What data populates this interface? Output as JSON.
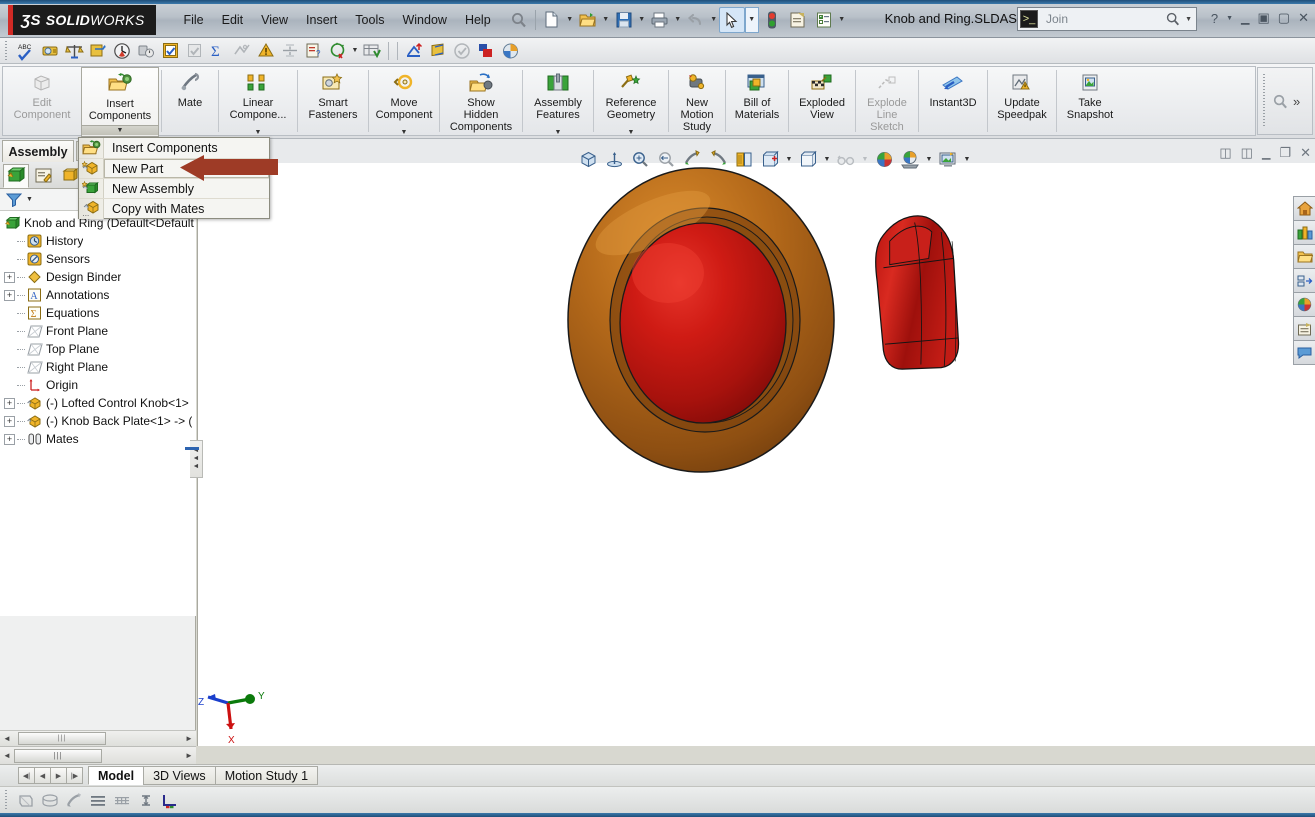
{
  "window": {
    "brand_ds": "ƷS",
    "brand_solid": "SOLID",
    "brand_works": "WORKS",
    "document_title": "Knob and Ring.SLDASM",
    "join_label": "Join",
    "join_icon": "console-icon",
    "search_icon": "magnifier-icon",
    "help_icon": "question-mark-icon",
    "minimize_icon": "minimize-icon",
    "restore_icon": "restore-icon",
    "close_icon": "close-icon",
    "accent_blue": "#2d64b0",
    "logo_red": "#d12a25"
  },
  "menu": {
    "items": [
      {
        "label": "File",
        "name": "menu-file"
      },
      {
        "label": "Edit",
        "name": "menu-edit"
      },
      {
        "label": "View",
        "name": "menu-view"
      },
      {
        "label": "Insert",
        "name": "menu-insert"
      },
      {
        "label": "Tools",
        "name": "menu-tools"
      },
      {
        "label": "Window",
        "name": "menu-window"
      },
      {
        "label": "Help",
        "name": "menu-help"
      }
    ]
  },
  "quick_access": {
    "buttons": [
      {
        "name": "search-commands-icon",
        "glyph": "magnifier"
      },
      {
        "name": "new-document-icon",
        "glyph": "page"
      },
      {
        "name": "open-document-icon",
        "glyph": "folder"
      },
      {
        "name": "save-icon",
        "glyph": "floppy"
      },
      {
        "name": "print-icon",
        "glyph": "printer"
      },
      {
        "name": "undo-icon",
        "glyph": "undo"
      },
      {
        "name": "select-icon",
        "glyph": "arrow-cursor"
      },
      {
        "name": "rebuild-icon",
        "glyph": "traffic-light"
      },
      {
        "name": "file-properties-icon",
        "glyph": "props"
      },
      {
        "name": "options-icon",
        "glyph": "list-check"
      }
    ]
  },
  "toolbar_row": {
    "icons": [
      {
        "name": "spell-checker-icon"
      },
      {
        "name": "measure-icon"
      },
      {
        "name": "mass-properties-icon"
      },
      {
        "name": "section-properties-icon"
      },
      {
        "name": "sensor-icon"
      },
      {
        "name": "performance-evaluation-icon"
      },
      {
        "name": "check-icon"
      },
      {
        "name": "check-disabled-icon"
      },
      {
        "name": "equations-icon"
      },
      {
        "name": "geometry-analysis-icon"
      },
      {
        "name": "interference-detection-icon"
      },
      {
        "name": "clearance-verification-icon"
      },
      {
        "name": "hole-alignment-icon"
      },
      {
        "name": "compare-documents-icon"
      },
      {
        "name": "import-diagnostics-icon"
      },
      {
        "name": "design-checker-icon"
      },
      {
        "name": "simulation-icon"
      },
      {
        "name": "motion-icon"
      },
      {
        "name": "verify-icon"
      },
      {
        "name": "appearance-icon"
      },
      {
        "name": "render-icon"
      }
    ]
  },
  "ribbon": {
    "commands": [
      {
        "label": "Edit\nComponent",
        "name": "edit-component-button",
        "icon": "edit-component-icon",
        "state": "disabled",
        "dropdown": false
      },
      {
        "label": "Insert\nComponents",
        "name": "insert-components-button",
        "icon": "insert-components-icon",
        "state": "active",
        "dropdown": true
      },
      {
        "label": "Mate",
        "name": "mate-button",
        "icon": "mate-icon",
        "state": "normal",
        "dropdown": false
      },
      {
        "label": "Linear\nCompone...",
        "name": "linear-component-pattern-button",
        "icon": "linear-pattern-icon",
        "state": "normal",
        "dropdown": true
      },
      {
        "label": "Smart\nFasteners",
        "name": "smart-fasteners-button",
        "icon": "smart-fasteners-icon",
        "state": "normal",
        "dropdown": false
      },
      {
        "label": "Move\nComponent",
        "name": "move-component-button",
        "icon": "move-component-icon",
        "state": "normal",
        "dropdown": true
      },
      {
        "label": "Show\nHidden\nComponents",
        "name": "show-hidden-components-button",
        "icon": "show-hidden-icon",
        "state": "normal",
        "dropdown": false
      },
      {
        "label": "Assembly\nFeatures",
        "name": "assembly-features-button",
        "icon": "assembly-features-icon",
        "state": "normal",
        "dropdown": true
      },
      {
        "label": "Reference\nGeometry",
        "name": "reference-geometry-button",
        "icon": "reference-geometry-icon",
        "state": "normal",
        "dropdown": true
      },
      {
        "label": "New\nMotion\nStudy",
        "name": "new-motion-study-button",
        "icon": "motion-study-icon",
        "state": "normal",
        "dropdown": false
      },
      {
        "label": "Bill of\nMaterials",
        "name": "bill-of-materials-button",
        "icon": "bom-icon",
        "state": "normal",
        "dropdown": false
      },
      {
        "label": "Exploded\nView",
        "name": "exploded-view-button",
        "icon": "exploded-view-icon",
        "state": "normal",
        "dropdown": false
      },
      {
        "label": "Explode\nLine\nSketch",
        "name": "explode-line-sketch-button",
        "icon": "explode-line-icon",
        "state": "disabled",
        "dropdown": false
      },
      {
        "label": "Instant3D",
        "name": "instant3d-button",
        "icon": "instant3d-icon",
        "state": "normal",
        "dropdown": false
      },
      {
        "label": "Update\nSpeedpak",
        "name": "update-speedpak-button",
        "icon": "speedpak-icon",
        "state": "normal",
        "dropdown": false
      },
      {
        "label": "Take\nSnapshot",
        "name": "take-snapshot-button",
        "icon": "snapshot-icon",
        "state": "normal",
        "dropdown": false
      }
    ],
    "overflow_icon": "magnifier-icon",
    "overflow_chevron": "»"
  },
  "command_tab": {
    "label": "Assembly"
  },
  "dropdown_menu": {
    "items": [
      {
        "label": "Insert Components",
        "name": "menu-item-insert-components",
        "icon": "insert-components-icon",
        "highlighted": false
      },
      {
        "label": "New Part",
        "name": "menu-item-new-part",
        "icon": "new-part-icon",
        "highlighted": true
      },
      {
        "label": "New Assembly",
        "name": "menu-item-new-assembly",
        "icon": "new-assembly-icon",
        "highlighted": false
      },
      {
        "label": "Copy with Mates",
        "name": "menu-item-copy-with-mates",
        "icon": "copy-with-mates-icon",
        "highlighted": false
      }
    ],
    "annotation": {
      "type": "arrow",
      "color": "#9e3b26",
      "points_to": "New Part"
    }
  },
  "feature_manager": {
    "tabs": [
      {
        "name": "tab-feature-manager-tree",
        "icon": "assembly-tree-icon",
        "selected": true
      },
      {
        "name": "tab-property-manager",
        "icon": "property-manager-icon",
        "selected": false
      },
      {
        "name": "tab-configuration-manager",
        "icon": "configuration-manager-icon",
        "selected": false
      }
    ],
    "filter_icon": "filter-icon",
    "filter_caret": "▼",
    "tree": [
      {
        "label": "Knob and Ring  (Default<Default",
        "icon": "assembly-icon",
        "indent": 0,
        "expander": "none",
        "name": "tree-item-assembly-root"
      },
      {
        "label": "History",
        "icon": "history-icon",
        "indent": 1,
        "expander": "none",
        "name": "tree-item-history"
      },
      {
        "label": "Sensors",
        "icon": "sensors-icon",
        "indent": 1,
        "expander": "none",
        "name": "tree-item-sensors"
      },
      {
        "label": "Design Binder",
        "icon": "design-binder-icon",
        "indent": 1,
        "expander": "plus",
        "name": "tree-item-design-binder"
      },
      {
        "label": "Annotations",
        "icon": "annotations-icon",
        "indent": 1,
        "expander": "plus",
        "name": "tree-item-annotations"
      },
      {
        "label": "Equations",
        "icon": "equations-icon",
        "indent": 1,
        "expander": "none",
        "name": "tree-item-equations"
      },
      {
        "label": "Front Plane",
        "icon": "plane-icon",
        "indent": 1,
        "expander": "none",
        "name": "tree-item-front-plane"
      },
      {
        "label": "Top Plane",
        "icon": "plane-icon",
        "indent": 1,
        "expander": "none",
        "name": "tree-item-top-plane"
      },
      {
        "label": "Right Plane",
        "icon": "plane-icon",
        "indent": 1,
        "expander": "none",
        "name": "tree-item-right-plane"
      },
      {
        "label": "Origin",
        "icon": "origin-icon",
        "indent": 1,
        "expander": "none",
        "name": "tree-item-origin"
      },
      {
        "label": "(-) Lofted Control Knob<1>",
        "icon": "part-icon",
        "indent": 1,
        "expander": "plus",
        "name": "tree-item-lofted-control-knob"
      },
      {
        "label": "(-) Knob Back Plate<1> -> (",
        "icon": "part-icon",
        "indent": 1,
        "expander": "plus",
        "name": "tree-item-knob-back-plate"
      },
      {
        "label": "Mates",
        "icon": "mates-icon",
        "indent": 1,
        "expander": "plus",
        "name": "tree-item-mates"
      }
    ],
    "scroll_left": "◄",
    "scroll_right": "►",
    "thumb_grip": "|||"
  },
  "view_toolbar": {
    "buttons": [
      {
        "name": "zoom-to-fit-icon",
        "glyph": "cube"
      },
      {
        "name": "normal-to-icon",
        "glyph": "normal-to"
      },
      {
        "name": "zoom-to-area-icon",
        "glyph": "zoom-area"
      },
      {
        "name": "previous-view-icon",
        "glyph": "zoom-prev"
      },
      {
        "name": "section-view-icon",
        "glyph": "section-plus"
      },
      {
        "name": "view-orientation-icon",
        "glyph": "section-minus"
      },
      {
        "name": "display-style-icon",
        "glyph": "book"
      },
      {
        "name": "hide-show-items-icon",
        "glyph": "cube-plus",
        "dropdown": true
      },
      {
        "name": "edit-appearance-icon",
        "glyph": "cube-plain",
        "dropdown": true
      },
      {
        "name": "apply-scene-icon",
        "glyph": "glasses",
        "dropdown": true,
        "disabled": true
      },
      {
        "name": "view-settings-icon",
        "glyph": "color-ball",
        "dropdown": false
      },
      {
        "name": "scene-icon",
        "glyph": "scene-ball",
        "dropdown": true
      },
      {
        "name": "view-setting-screen-icon",
        "glyph": "screen",
        "dropdown": true
      }
    ],
    "window_controls": [
      {
        "name": "restore-left-panel-icon",
        "glyph": "▣"
      },
      {
        "name": "restore-right-panel-icon",
        "glyph": "▣"
      },
      {
        "name": "minimize-doc-icon",
        "glyph": "—"
      },
      {
        "name": "restore-doc-icon",
        "glyph": "❐"
      },
      {
        "name": "close-doc-icon",
        "glyph": "✕"
      }
    ]
  },
  "task_pane": {
    "tabs": [
      {
        "name": "task-pane-resources-tab",
        "icon": "home-icon"
      },
      {
        "name": "task-pane-design-library-tab",
        "icon": "library-icon"
      },
      {
        "name": "task-pane-file-explorer-tab",
        "icon": "folder-icon"
      },
      {
        "name": "task-pane-view-palette-tab",
        "icon": "view-palette-icon"
      },
      {
        "name": "task-pane-appearances-tab",
        "icon": "appearances-ball-icon"
      },
      {
        "name": "task-pane-custom-props-tab",
        "icon": "custom-properties-icon"
      },
      {
        "name": "task-pane-forum-tab",
        "icon": "speech-bubble-icon"
      }
    ]
  },
  "graphics": {
    "model_name": "Knob and Ring",
    "knob_color": "#c0160f",
    "ring_color": "#b0691a",
    "background": "#ffffff",
    "triad": {
      "x_axis_label": "",
      "y_axis_label": "Y",
      "z_axis_label": "Z",
      "x_color": "#cc1111",
      "y_color": "#0b7a0b",
      "z_color": "#1a3fcc"
    }
  },
  "bottom": {
    "nav_buttons": [
      {
        "name": "first-tab-button",
        "glyph": "◀|"
      },
      {
        "name": "prev-tab-button",
        "glyph": "◀"
      },
      {
        "name": "next-tab-button",
        "glyph": "▶"
      },
      {
        "name": "last-tab-button",
        "glyph": "|▶"
      }
    ],
    "tabs": [
      {
        "label": "Model",
        "name": "tab-model",
        "selected": true
      },
      {
        "label": "3D Views",
        "name": "tab-3d-views",
        "selected": false
      },
      {
        "label": "Motion Study 1",
        "name": "tab-motion-study-1",
        "selected": false
      }
    ],
    "status_icons": [
      {
        "name": "section-view-status-icon"
      },
      {
        "name": "layers-status-icon"
      },
      {
        "name": "shadow-status-icon"
      },
      {
        "name": "perspective-status-icon"
      },
      {
        "name": "grid-status-icon"
      },
      {
        "name": "units-status-icon"
      },
      {
        "name": "measure-status-icon"
      }
    ]
  }
}
